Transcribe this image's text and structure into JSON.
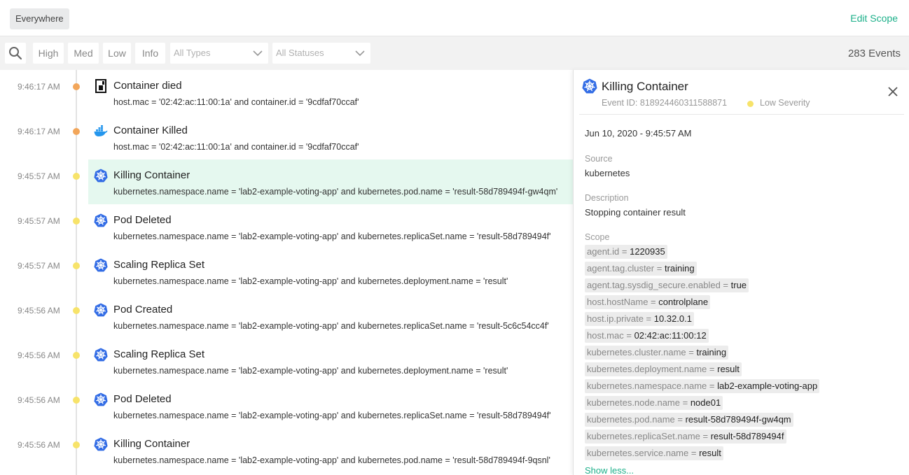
{
  "topbar": {
    "scope": "Everywhere",
    "edit_scope": "Edit Scope"
  },
  "filters": {
    "severities": [
      "High",
      "Med",
      "Low",
      "Info"
    ],
    "types_placeholder": "All Types",
    "status_placeholder": "All Statuses",
    "event_count": "283 Events"
  },
  "colors": {
    "accent": "#1db08a",
    "orange": "#f2a65a",
    "yellow": "#f7e36a",
    "k8s": "#326ce5",
    "docker": "#2496ed"
  },
  "events": [
    {
      "time": "9:46:17 AM",
      "title": "Container died",
      "detail": "host.mac = '02:42:ac:11:00:1a' and container.id = '9cdfaf70ccaf'",
      "icon": "container-icon",
      "severity": "orange"
    },
    {
      "time": "9:46:17 AM",
      "title": "Container Killed",
      "detail": "host.mac = '02:42:ac:11:00:1a' and container.id = '9cdfaf70ccaf'",
      "icon": "docker-icon",
      "severity": "orange"
    },
    {
      "time": "9:45:57 AM",
      "title": "Killing Container",
      "detail": "kubernetes.namespace.name = 'lab2-example-voting-app' and kubernetes.pod.name = 'result-58d789494f-gw4qm'",
      "icon": "kubernetes-icon",
      "severity": "yellow",
      "selected": true
    },
    {
      "time": "9:45:57 AM",
      "title": "Pod Deleted",
      "detail": "kubernetes.namespace.name = 'lab2-example-voting-app' and kubernetes.replicaSet.name = 'result-58d789494f'",
      "icon": "kubernetes-icon",
      "severity": "yellow"
    },
    {
      "time": "9:45:57 AM",
      "title": "Scaling Replica Set",
      "detail": "kubernetes.namespace.name = 'lab2-example-voting-app' and kubernetes.deployment.name = 'result'",
      "icon": "kubernetes-icon",
      "severity": "yellow"
    },
    {
      "time": "9:45:56 AM",
      "title": "Pod Created",
      "detail": "kubernetes.namespace.name = 'lab2-example-voting-app' and kubernetes.replicaSet.name = 'result-5c6c54cc4f'",
      "icon": "kubernetes-icon",
      "severity": "yellow"
    },
    {
      "time": "9:45:56 AM",
      "title": "Scaling Replica Set",
      "detail": "kubernetes.namespace.name = 'lab2-example-voting-app' and kubernetes.deployment.name = 'result'",
      "icon": "kubernetes-icon",
      "severity": "yellow"
    },
    {
      "time": "9:45:56 AM",
      "title": "Pod Deleted",
      "detail": "kubernetes.namespace.name = 'lab2-example-voting-app' and kubernetes.replicaSet.name = 'result-58d789494f'",
      "icon": "kubernetes-icon",
      "severity": "yellow"
    },
    {
      "time": "9:45:56 AM",
      "title": "Killing Container",
      "detail": "kubernetes.namespace.name = 'lab2-example-voting-app' and kubernetes.pod.name = 'result-58d789494f-9qsnl'",
      "icon": "kubernetes-icon",
      "severity": "yellow"
    }
  ],
  "panel": {
    "title": "Killing Container",
    "event_id": "Event ID: 818924460311588871",
    "severity_label": "Low Severity",
    "date": "Jun 10, 2020 - 9:45:57 AM",
    "source_label": "Source",
    "source_value": "kubernetes",
    "description_label": "Description",
    "description_value": "Stopping container result",
    "scope_label": "Scope",
    "scope": [
      {
        "key": "agent.id",
        "value": "1220935"
      },
      {
        "key": "agent.tag.cluster",
        "value": "training"
      },
      {
        "key": "agent.tag.sysdig_secure.enabled",
        "value": "true"
      },
      {
        "key": "host.hostName",
        "value": "controlplane"
      },
      {
        "key": "host.ip.private",
        "value": "10.32.0.1"
      },
      {
        "key": "host.mac",
        "value": "02:42:ac:11:00:12"
      },
      {
        "key": "kubernetes.cluster.name",
        "value": "training"
      },
      {
        "key": "kubernetes.deployment.name",
        "value": "result"
      },
      {
        "key": "kubernetes.namespace.name",
        "value": "lab2-example-voting-app"
      },
      {
        "key": "kubernetes.node.name",
        "value": "node01"
      },
      {
        "key": "kubernetes.pod.name",
        "value": "result-58d789494f-gw4qm"
      },
      {
        "key": "kubernetes.replicaSet.name",
        "value": "result-58d789494f"
      },
      {
        "key": "kubernetes.service.name",
        "value": "result"
      }
    ],
    "show_less": "Show less..."
  }
}
